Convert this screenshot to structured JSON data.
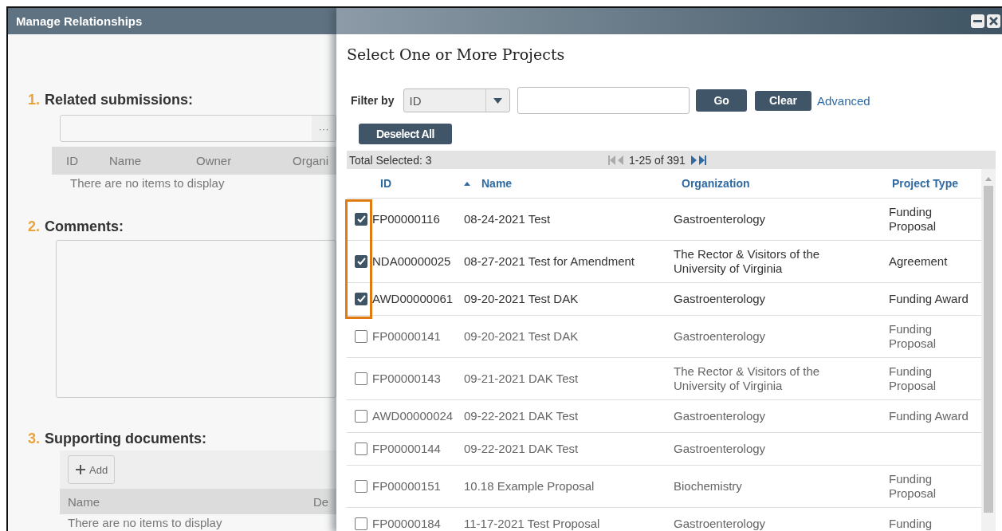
{
  "background_dialog": {
    "title": "Manage Relationships",
    "sections": [
      {
        "number": "1.",
        "label": "Related submissions:",
        "kind": "picker",
        "picker_button": "···",
        "columns": [
          "ID",
          "Name",
          "Owner",
          "Organi"
        ],
        "empty_text": "There are no items to display"
      },
      {
        "number": "2.",
        "label": "Comments:",
        "kind": "textarea"
      },
      {
        "number": "3.",
        "label": "Supporting documents:",
        "kind": "documents",
        "add_button": "Add",
        "columns": [
          "Name",
          "De"
        ],
        "empty_text": "There are no items to display"
      }
    ]
  },
  "modal": {
    "heading": "Select One or More Projects",
    "filter": {
      "label": "Filter by",
      "field": "ID",
      "buttons": [
        "Go",
        "Clear"
      ],
      "link": "Advanced"
    },
    "deselect_button": "Deselect All",
    "total_selected": "Total Selected: 3",
    "pager": "1-25 of 391",
    "columns": [
      {
        "label": "ID",
        "sorted": false
      },
      {
        "label": "Name",
        "sorted": true
      },
      {
        "label": "Organization",
        "sorted": false
      },
      {
        "label": "Project Type",
        "sorted": false
      }
    ],
    "rows": [
      {
        "selected": true,
        "id": "FP00000116",
        "name": "08-24-2021 Test",
        "organization": "Gastroenterology",
        "type": "Funding Proposal"
      },
      {
        "selected": true,
        "id": "NDA00000025",
        "name": "08-27-2021 Test for Amendment",
        "organization": "The Rector & Visitors of the University of Virginia",
        "type": "Agreement"
      },
      {
        "selected": true,
        "id": "AWD00000061",
        "name": "09-20-2021 Test DAK",
        "organization": "Gastroenterology",
        "type": "Funding Award"
      },
      {
        "selected": false,
        "id": "FP00000141",
        "name": "09-20-2021 Test DAK",
        "organization": "Gastroenterology",
        "type": "Funding Proposal"
      },
      {
        "selected": false,
        "id": "FP00000143",
        "name": "09-21-2021 DAK Test",
        "organization": "The Rector & Visitors of the University of Virginia",
        "type": "Funding Proposal"
      },
      {
        "selected": false,
        "id": "AWD00000024",
        "name": "09-22-2021 DAK Test",
        "organization": "Gastroenterology",
        "type": "Funding Award"
      },
      {
        "selected": false,
        "id": "FP00000144",
        "name": "09-22-2021 DAK Test",
        "organization": "Gastroenterology"
      },
      {
        "selected": false,
        "id": "FP00000151",
        "name": "10.18 Example Proposal",
        "organization": "Biochemistry",
        "type": "Funding Proposal"
      },
      {
        "selected": false,
        "id": "FP00000184",
        "name": "11-17-2021 Test Proposal",
        "organization": "Gastroenterology",
        "type": "Funding"
      }
    ]
  }
}
